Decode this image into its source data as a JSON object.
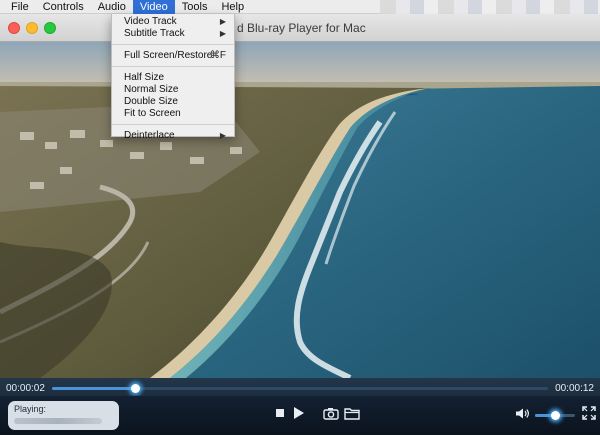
{
  "menubar": {
    "items": [
      {
        "label": "File"
      },
      {
        "label": "Controls"
      },
      {
        "label": "Audio"
      },
      {
        "label": "Video"
      },
      {
        "label": "Tools"
      },
      {
        "label": "Help"
      }
    ],
    "active": "Video"
  },
  "window": {
    "title": "d Blu-ray Player for Mac"
  },
  "video_menu": {
    "video_track": "Video Track",
    "subtitle_track": "Subtitle Track",
    "full_screen": "Full Screen/Restore",
    "full_screen_shortcut": "⌘F",
    "half_size": "Half Size",
    "normal_size": "Normal Size",
    "double_size": "Double Size",
    "fit_to_screen": "Fit to Screen",
    "deinterlace": "Deinterlace",
    "submenu_arrow": "▶"
  },
  "playback": {
    "current_time": "00:00:02",
    "duration": "00:00:12",
    "progress_fraction": 0.167,
    "volume_fraction": 0.5,
    "playing_label": "Playing:"
  },
  "colors": {
    "menu_highlight": "#2f6fd6",
    "seek_fill": "#4a93d8",
    "control_bar": "#1a2a3c"
  },
  "icons": {
    "stop": "stop-icon",
    "play": "play-icon",
    "snapshot": "camera-icon",
    "open": "folder-icon",
    "volume": "speaker-icon",
    "fullscreen": "fullscreen-icon"
  }
}
